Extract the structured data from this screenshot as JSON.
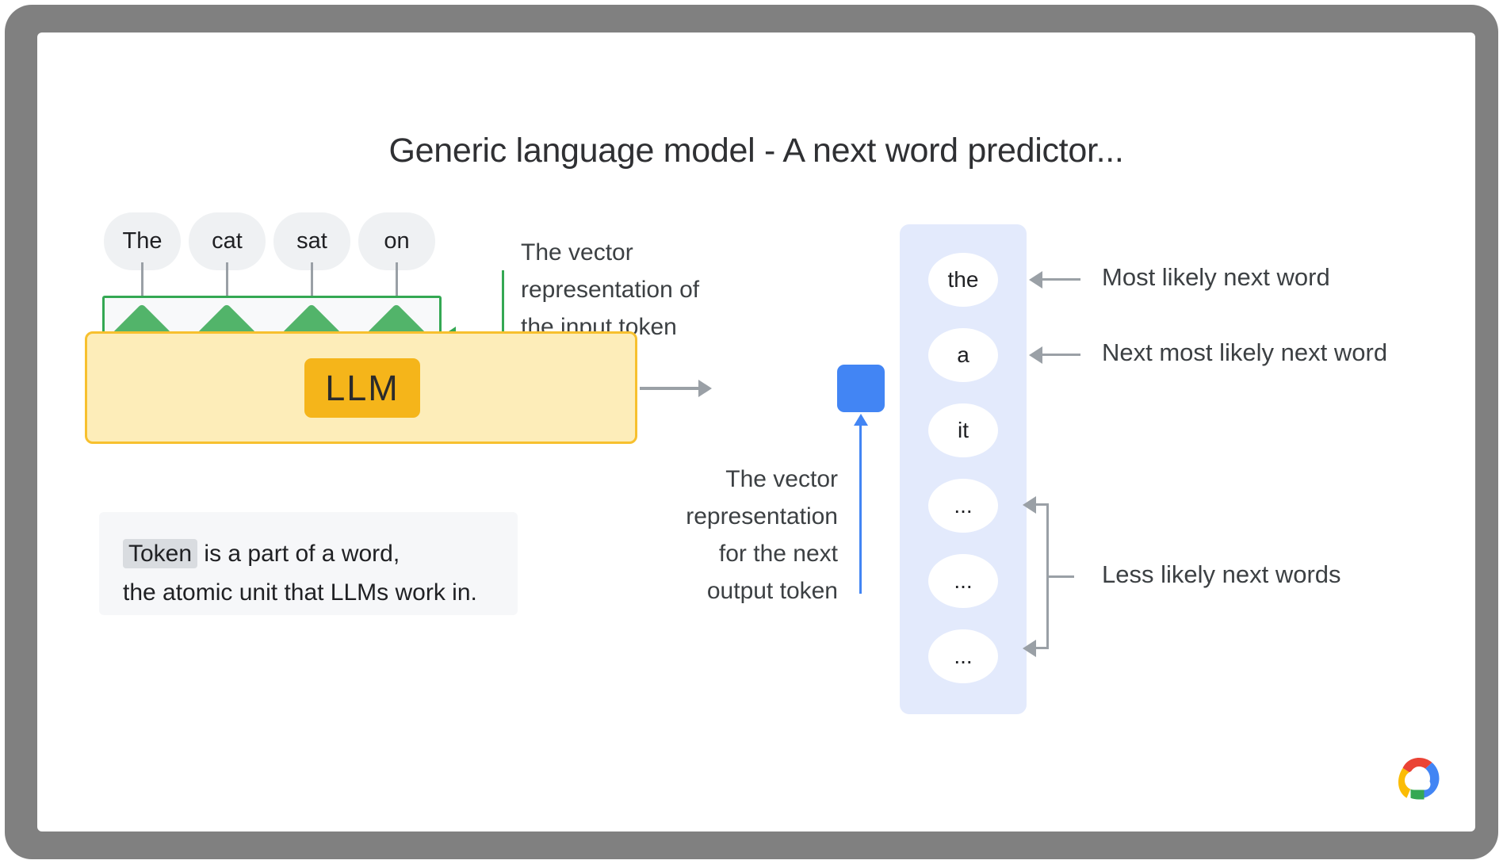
{
  "slide": {
    "title": "Generic language model - A next word predictor...",
    "logo": "google-cloud-logo"
  },
  "input": {
    "tokens": [
      "The",
      "cat",
      "sat",
      "on"
    ],
    "embedding_note": "The vector representation of the input token"
  },
  "model": {
    "label": "LLM"
  },
  "output_vector": {
    "note": "The vector representation for the next output token"
  },
  "token_callout": {
    "keyword": "Token",
    "line1_rest": " is a part of a word,",
    "line2": "the atomic unit that LLMs work in."
  },
  "predictions": {
    "items": [
      "the",
      "a",
      "it",
      "...",
      "...",
      "..."
    ],
    "annotations": [
      "Most likely next word",
      "Next most likely next word",
      "Less likely next words"
    ]
  },
  "colors": {
    "green": "#34a853",
    "green_fill": "#52b46a",
    "yellow_border": "#f7c02e",
    "yellow_fill": "#fdedb9",
    "amber": "#f5b51a",
    "blue": "#4285f4",
    "panel_blue": "#e3eafc",
    "gray_arrow": "#9aa0a6",
    "chip_gray": "#eff1f3",
    "bezel": "#808080"
  }
}
